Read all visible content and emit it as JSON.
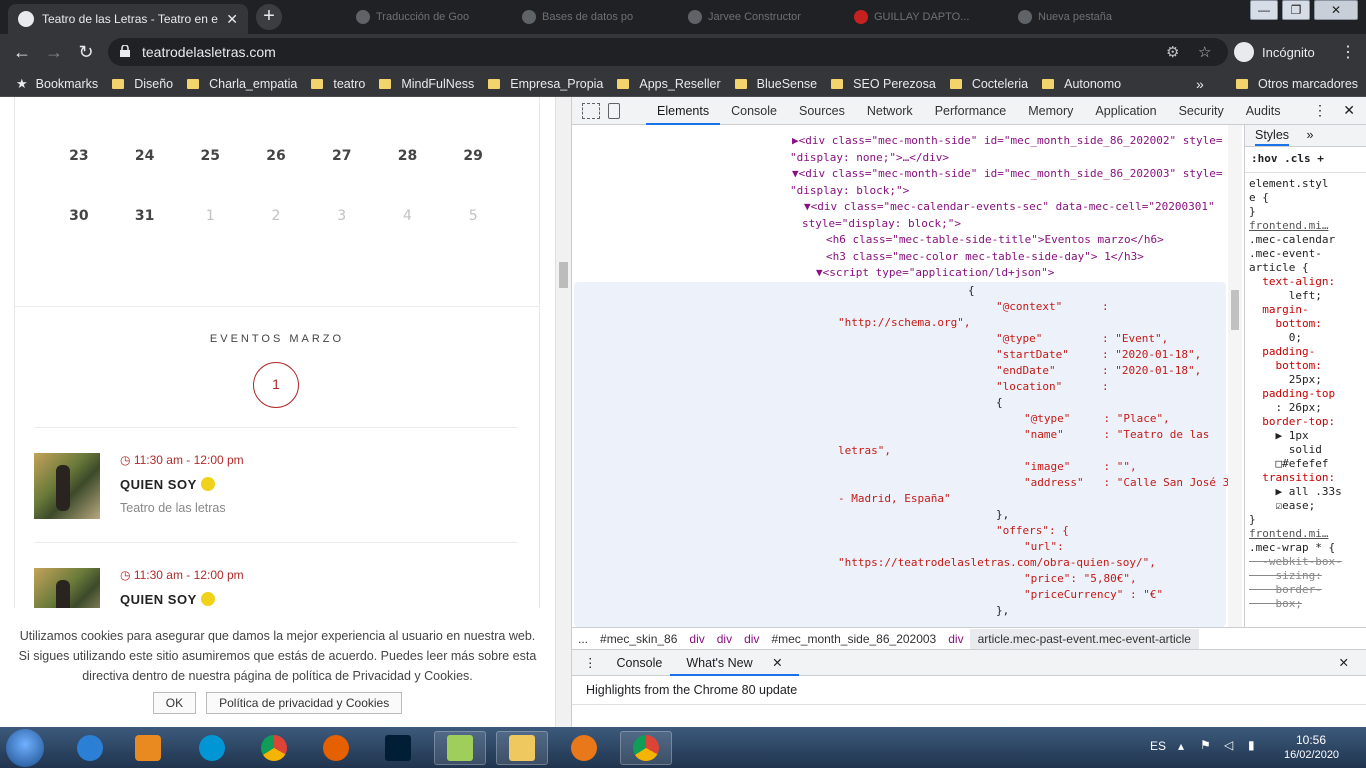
{
  "tabs": {
    "active_title": "Teatro de las Letras - Teatro en e",
    "background": [
      {
        "label": "Traducción de Goo"
      },
      {
        "label": "Bases de datos po"
      },
      {
        "label": "Jarvee Constructor"
      },
      {
        "label": "GUILLAY DAPTO..."
      },
      {
        "label": "Nueva pestaña"
      }
    ]
  },
  "window": {
    "minimize": "—",
    "maximize": "❐",
    "close": "✕"
  },
  "toolbar": {
    "back": "←",
    "forward": "→",
    "reload": "↻",
    "url": "teatrodelasletras.com",
    "incognito_label": "Incógnito",
    "menu": "⋮"
  },
  "bookmarks": {
    "main": "Bookmarks",
    "folders": [
      "Diseño",
      "Charla_empatia",
      "teatro",
      "MindFulNess",
      "Empresa_Propia",
      "Apps_Reseller",
      "BlueSense",
      "SEO Perezosa",
      "Cocteleria",
      "Autonomo"
    ],
    "more": "»",
    "other": "Otros marcadores"
  },
  "calendar": {
    "week1": [
      {
        "d": "23",
        "muted": false
      },
      {
        "d": "24",
        "muted": false
      },
      {
        "d": "25",
        "muted": false
      },
      {
        "d": "26",
        "muted": false
      },
      {
        "d": "27",
        "muted": false
      },
      {
        "d": "28",
        "muted": false
      },
      {
        "d": "29",
        "muted": false
      }
    ],
    "week2": [
      {
        "d": "30",
        "muted": false
      },
      {
        "d": "31",
        "muted": false
      },
      {
        "d": "1",
        "muted": true
      },
      {
        "d": "2",
        "muted": true
      },
      {
        "d": "3",
        "muted": true
      },
      {
        "d": "4",
        "muted": true
      },
      {
        "d": "5",
        "muted": true
      }
    ]
  },
  "events": {
    "heading": "EVENTOS MARZO",
    "day": "1",
    "items": [
      {
        "time": "11:30 am - 12:00 pm",
        "title": "QUIEN SOY",
        "location": "Teatro de las letras"
      },
      {
        "time": "11:30 am - 12:00 pm",
        "title": "QUIEN SOY",
        "location": ""
      }
    ]
  },
  "cookie": {
    "text": "Utilizamos cookies para asegurar que damos la mejor experiencia al usuario en nuestra web. Si sigues utilizando este sitio asumiremos que estás de acuerdo. Puedes leer más sobre esta directiva dentro de nuestra página de política de Privacidad y Cookies.",
    "ok": "OK",
    "policy": "Política de privacidad y Cookies"
  },
  "devtools": {
    "tabs": [
      "Elements",
      "Console",
      "Sources",
      "Network",
      "Performance",
      "Memory",
      "Application",
      "Security",
      "Audits"
    ],
    "active_tab": "Elements",
    "dom_lines": [
      "▶<div class=\"mec-month-side\" id=\"mec_month_side_86_202002\" style=",
      "\"display: none;\">…</div>",
      "▼<div class=\"mec-month-side\" id=\"mec_month_side_86_202003\" style=",
      "\"display: block;\">",
      "▼<div class=\"mec-calendar-events-sec\" data-mec-cell=\"20200301\"",
      "style=\"display: block;\">",
      "<h6 class=\"mec-table-side-title\">Eventos marzo</h6>",
      "<h3 class=\"mec-color mec-table-side-day\"> 1</h3>",
      "▼<script type=\"application/ld+json\">"
    ],
    "json_lines": [
      "{",
      "\"@context\"      :",
      "\"http://schema.org\",",
      "\"@type\"         : \"Event\",",
      "\"startDate\"     : \"2020-01-18\",",
      "\"endDate\"       : \"2020-01-18\",",
      "\"location\"      :",
      "{",
      "\"@type\"     : \"Place\",",
      "\"name\"      : \"Teatro de las",
      "letras\",",
      "\"image\"     : \"\",",
      "\"address\"   : \"Calle San José 3",
      "- Madrid, España\"",
      "},",
      "\"offers\": {",
      "\"url\":",
      "\"https://teatrodelasletras.com/obra-quien-soy/\",",
      "\"price\": \"5,80€\",",
      "\"priceCurrency\" : \"€\"",
      "},"
    ],
    "styles_tab": "Styles",
    "styles_more": "»",
    "filter": ":hov  .cls  +",
    "styles_lines": [
      {
        "t": "element.styl",
        "c": "val"
      },
      {
        "t": "e {",
        "c": "val"
      },
      {
        "t": "}",
        "c": "val"
      },
      {
        "t": "frontend.mi…",
        "c": "src"
      },
      {
        "t": ".mec-calendar",
        "c": "val"
      },
      {
        "t": ".mec-event-",
        "c": "val"
      },
      {
        "t": "article {",
        "c": "val"
      },
      {
        "t": "  text-align:",
        "c": "prop"
      },
      {
        "t": "      left;",
        "c": "val"
      },
      {
        "t": "  margin-",
        "c": "prop"
      },
      {
        "t": "    bottom:",
        "c": "prop"
      },
      {
        "t": "      0;",
        "c": "val"
      },
      {
        "t": "  padding-",
        "c": "prop"
      },
      {
        "t": "    bottom:",
        "c": "prop"
      },
      {
        "t": "      25px;",
        "c": "val"
      },
      {
        "t": "  padding-top",
        "c": "prop"
      },
      {
        "t": "    : 26px;",
        "c": "val"
      },
      {
        "t": "  border-top:",
        "c": "prop"
      },
      {
        "t": "    ▶ 1px",
        "c": "val"
      },
      {
        "t": "      solid",
        "c": "val"
      },
      {
        "t": "    □#efefef",
        "c": "val"
      },
      {
        "t": "  transition:",
        "c": "prop"
      },
      {
        "t": "    ▶ all .33s",
        "c": "val"
      },
      {
        "t": "    ☑ease;",
        "c": "val"
      },
      {
        "t": "}",
        "c": "val"
      },
      {
        "t": "frontend.mi…",
        "c": "src"
      },
      {
        "t": ".mec-wrap * {",
        "c": "val"
      },
      {
        "t": "  -webkit-box-",
        "c": "strike"
      },
      {
        "t": "    sizing:",
        "c": "strike"
      },
      {
        "t": "    border-",
        "c": "strike"
      },
      {
        "t": "    box;",
        "c": "strike"
      }
    ],
    "breadcrumbs": [
      "...",
      "#mec_skin_86",
      "div",
      "div",
      "div",
      "#mec_month_side_86_202003",
      "div",
      "article.mec-past-event.mec-event-article"
    ],
    "drawer_tabs": [
      "Console",
      "What's New"
    ],
    "drawer_close": "✕",
    "highlights": "Highlights from the Chrome 80 update",
    "close": "✕"
  },
  "taskbar": {
    "lang": "ES",
    "time": "10:56",
    "date": "16/02/2020"
  }
}
